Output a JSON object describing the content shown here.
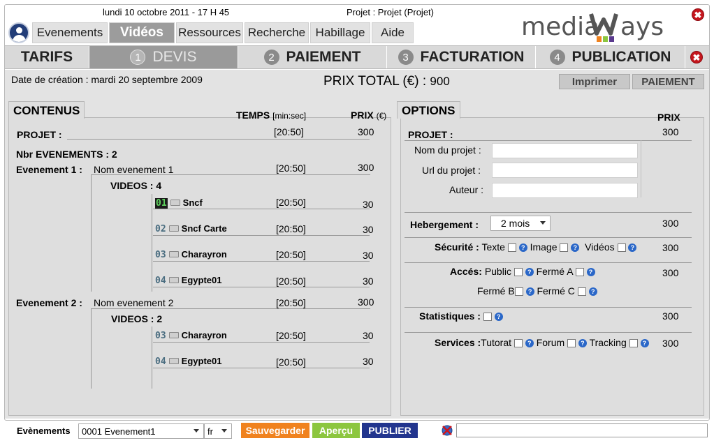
{
  "header": {
    "datetime": "lundi 10 octobre 2011 - 17 H 45",
    "project": "Projet : Projet (Projet)",
    "logo_text": "mediaWays",
    "close_symbol": "✖"
  },
  "nav_tabs": [
    {
      "label": "Evenements"
    },
    {
      "label": "Vidéos"
    },
    {
      "label": "Ressources"
    },
    {
      "label": "Recherche"
    },
    {
      "label": "Habillage"
    },
    {
      "label": "Aide"
    }
  ],
  "steps": [
    {
      "num": "",
      "label": "TARIFS"
    },
    {
      "num": "1",
      "label": "DEVIS"
    },
    {
      "num": "2",
      "label": "PAIEMENT"
    },
    {
      "num": "3",
      "label": "FACTURATION"
    },
    {
      "num": "4",
      "label": "PUBLICATION"
    }
  ],
  "devis": {
    "creation_date": "Date de création : mardi 20 septembre 2009",
    "total_label": "PRIX TOTAL (€) :",
    "total_value": "900",
    "print_button": "Imprimer",
    "pay_button": "PAIEMENT"
  },
  "contenus": {
    "title": "CONTENUS",
    "temps_header": "TEMPS",
    "temps_unit": "[min:sec]",
    "prix_header": "PRIX",
    "prix_unit": "(€)",
    "projet_label": "PROJET :",
    "projet_time": "[20:50]",
    "projet_price": "300",
    "nbr_events": "Nbr EVENEMENTS : 2",
    "events": [
      {
        "label": "Evenement 1 :",
        "name": "Nom evenement 1",
        "time": "[20:50]",
        "price": "300",
        "videos_label": "VIDEOS : 4",
        "videos": [
          {
            "num": "01",
            "name": "Sncf",
            "time": "[20:50]",
            "price": "30"
          },
          {
            "num": "02",
            "name": "Sncf Carte",
            "time": "[20:50]",
            "price": "30"
          },
          {
            "num": "03",
            "name": "Charayron",
            "time": "[20:50]",
            "price": "30"
          },
          {
            "num": "04",
            "name": "Egypte01",
            "time": "[20:50]",
            "price": "30"
          }
        ]
      },
      {
        "label": "Evenement 2 :",
        "name": "Nom evenement 2",
        "time": "[20:50]",
        "price": "300",
        "videos_label": "VIDEOS : 2",
        "videos": [
          {
            "num": "03",
            "name": "Charayron",
            "time": "[20:50]",
            "price": "30"
          },
          {
            "num": "04",
            "name": "Egypte01",
            "time": "[20:50]",
            "price": "30"
          }
        ]
      }
    ]
  },
  "options": {
    "title": "OPTIONS",
    "prix_header": "PRIX",
    "projet_label": "PROJET :",
    "projet_price": "300",
    "nom_label": "Nom du projet :",
    "url_label": "Url du projet :",
    "auteur_label": "Auteur :",
    "hebergement_label": "Hebergement :",
    "hebergement_value": "2 mois",
    "hebergement_price": "300",
    "securite_label": "Sécurité :",
    "securite_items": [
      "Texte",
      "Image",
      "Vidéos"
    ],
    "securite_price": "300",
    "acces_label": "Accés:",
    "acces_row1": [
      "Public",
      "Fermé A"
    ],
    "acces_row2": [
      "Fermé B",
      "Fermé C"
    ],
    "acces_price": "300",
    "stats_label": "Statistiques :",
    "stats_price": "300",
    "services_label": "Services :",
    "services_items": [
      "Tutorat",
      "Forum",
      "Tracking"
    ],
    "services_price": "300"
  },
  "bottom": {
    "label": "Evènements",
    "event_select": "0001 Evenement1",
    "lang_select": "fr",
    "save": "Sauvegarder",
    "preview": "Aperçu",
    "publish": "PUBLIER"
  },
  "colors": {
    "save": "#f0821e",
    "preview": "#8cc63f",
    "publish": "#22358e",
    "close": "#c5161d"
  }
}
